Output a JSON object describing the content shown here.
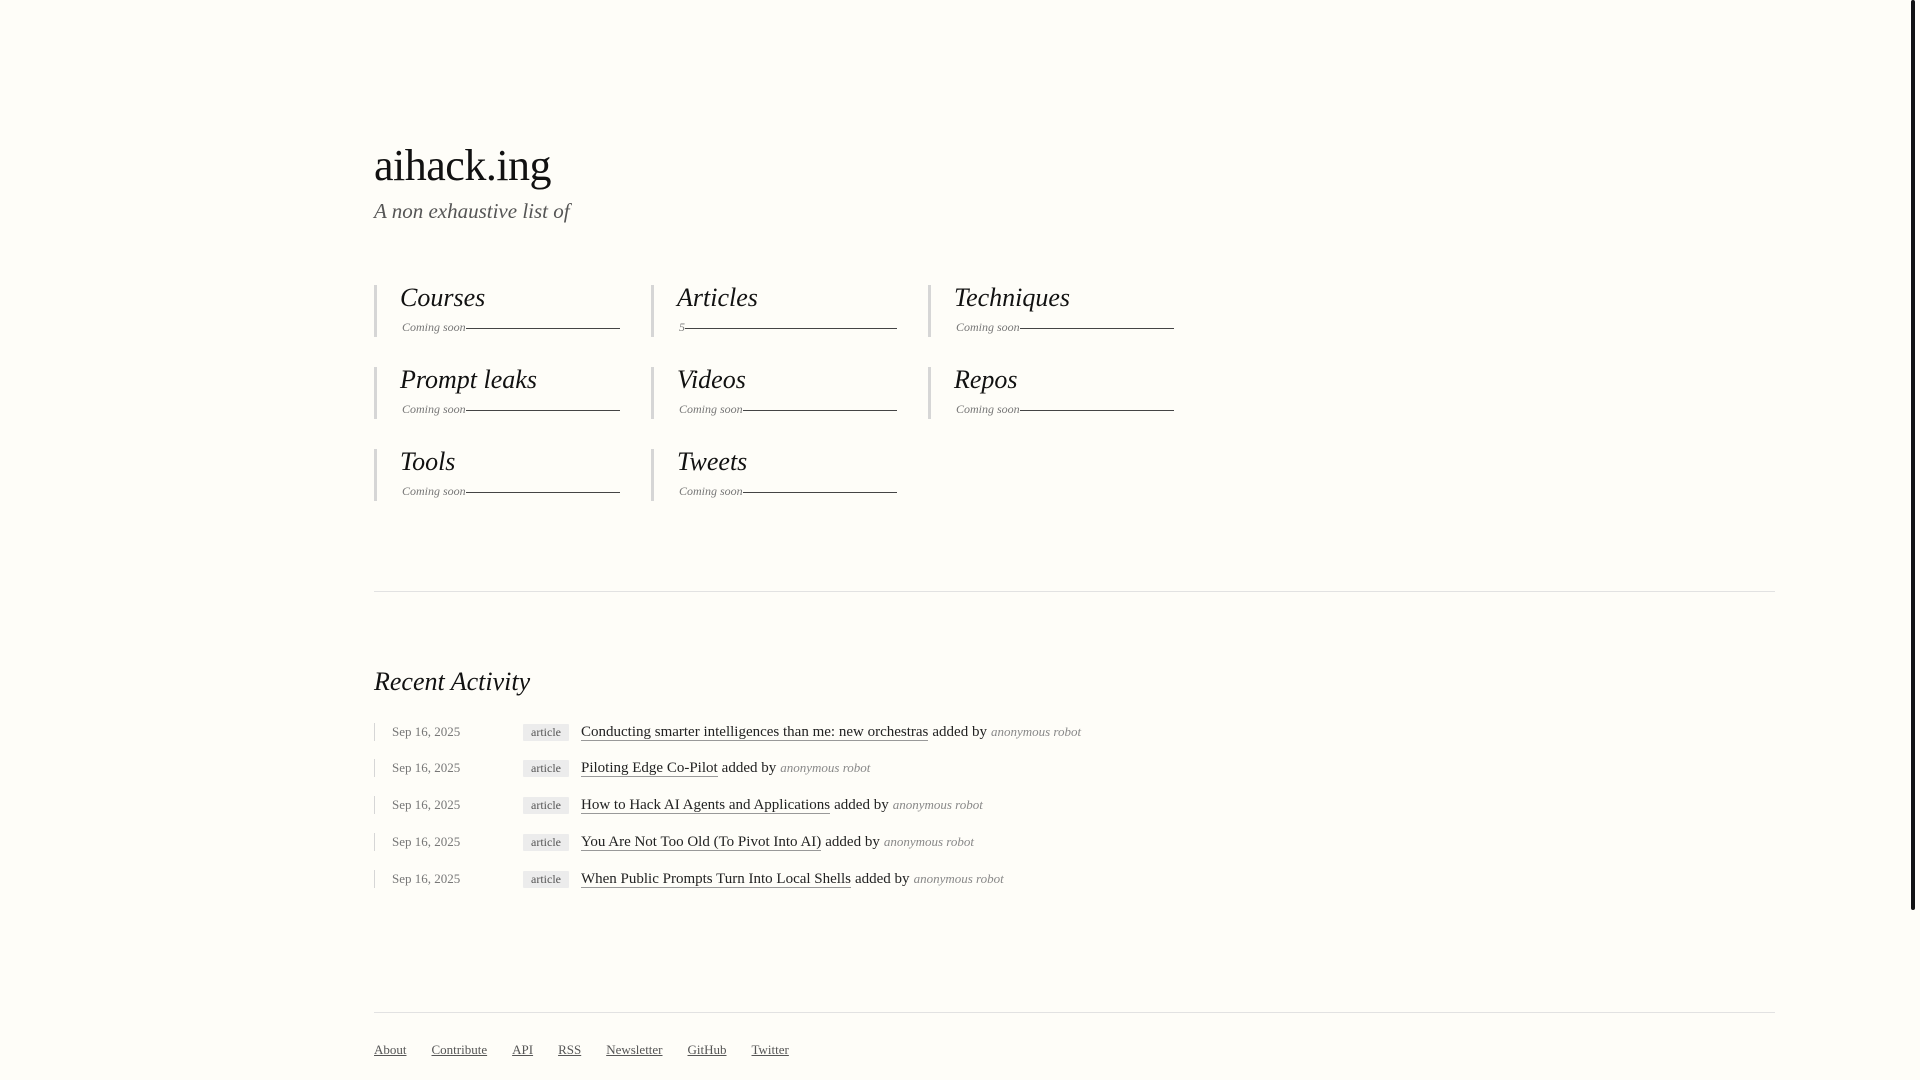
{
  "header": {
    "site_title": "aihack.ing",
    "tagline": "A non exhaustive list of"
  },
  "categories": [
    {
      "label": "Courses",
      "meta": "Coming soon"
    },
    {
      "label": "Articles",
      "meta": "5"
    },
    {
      "label": "Techniques",
      "meta": "Coming soon"
    },
    {
      "label": "Prompt leaks",
      "meta": "Coming soon"
    },
    {
      "label": "Videos",
      "meta": "Coming soon"
    },
    {
      "label": "Repos",
      "meta": "Coming soon"
    },
    {
      "label": "Tools",
      "meta": "Coming soon"
    },
    {
      "label": "Tweets",
      "meta": "Coming soon"
    }
  ],
  "recent_activity": {
    "title": "Recent Activity",
    "items": [
      {
        "date": "Sep 16, 2025",
        "type": "article",
        "title": "Conducting smarter intelligences than me: new orchestras",
        "added_by": "added by",
        "author": "anonymous robot"
      },
      {
        "date": "Sep 16, 2025",
        "type": "article",
        "title": "Piloting Edge Co-Pilot",
        "added_by": "added by",
        "author": "anonymous robot"
      },
      {
        "date": "Sep 16, 2025",
        "type": "article",
        "title": "How to Hack AI Agents and Applications",
        "added_by": "added by",
        "author": "anonymous robot"
      },
      {
        "date": "Sep 16, 2025",
        "type": "article",
        "title": "You Are Not Too Old (To Pivot Into AI)",
        "added_by": "added by",
        "author": "anonymous robot"
      },
      {
        "date": "Sep 16, 2025",
        "type": "article",
        "title": "When Public Prompts Turn Into Local Shells",
        "added_by": "added by",
        "author": "anonymous robot"
      }
    ]
  },
  "footer": {
    "links": [
      "About",
      "Contribute",
      "API",
      "RSS",
      "Newsletter",
      "GitHub",
      "Twitter"
    ]
  }
}
